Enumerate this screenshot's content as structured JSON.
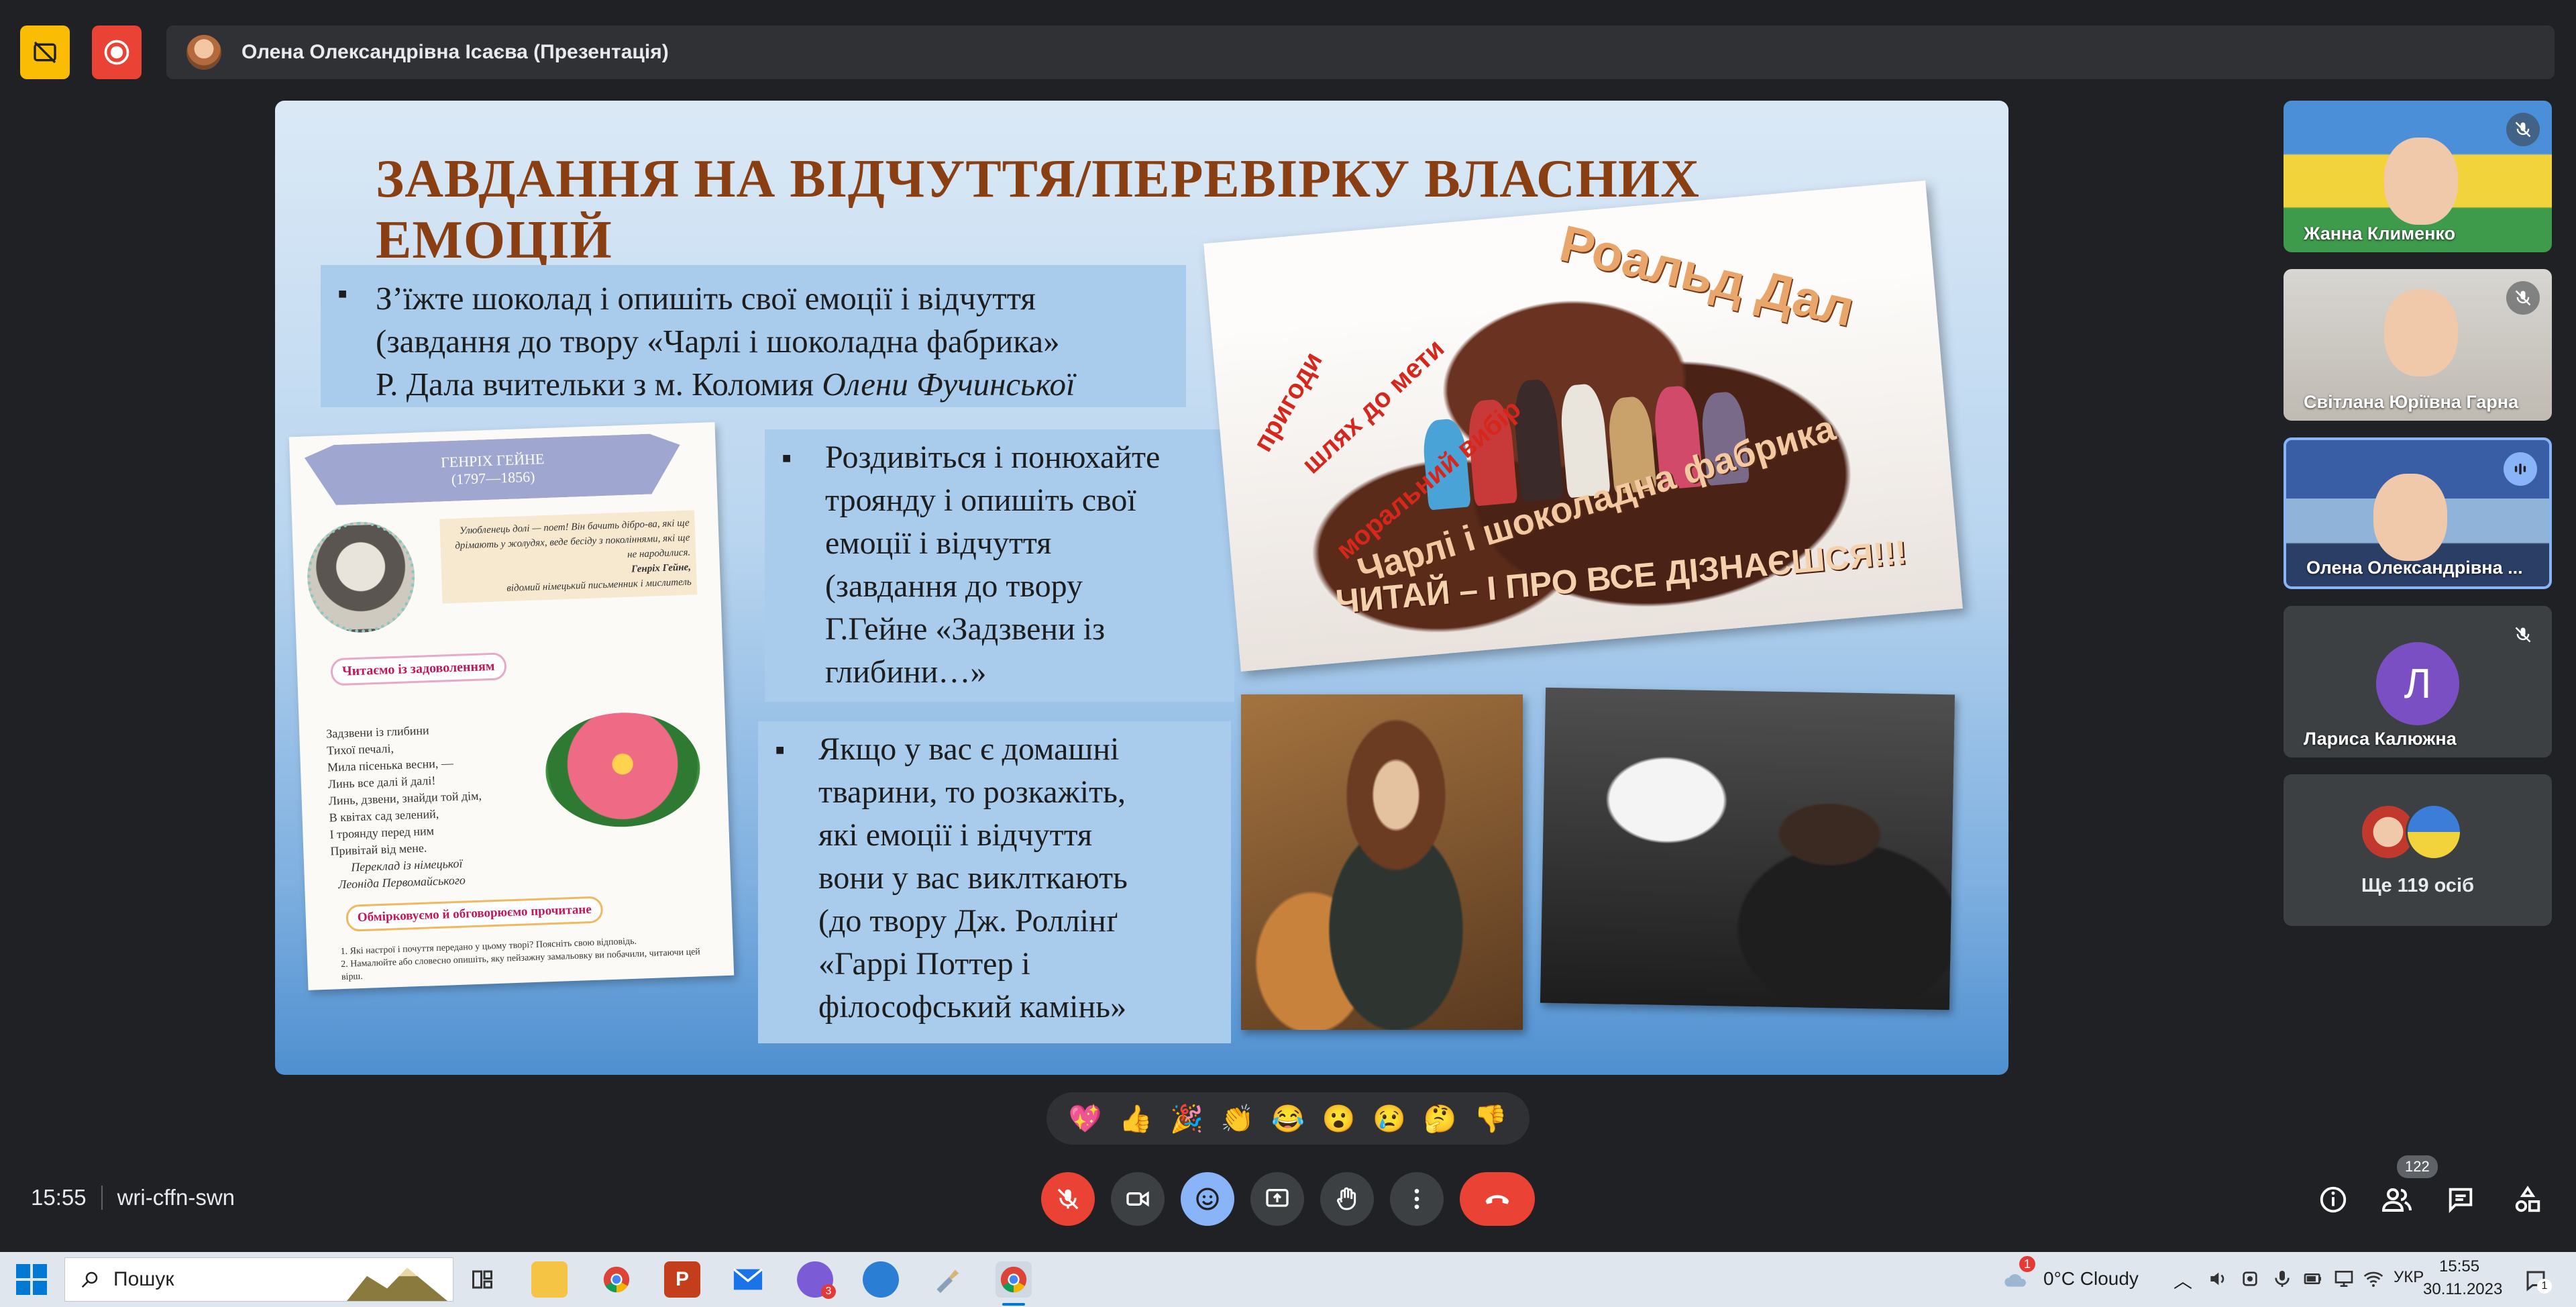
{
  "top_bar": {
    "presenter_name": "Олена Олександрівна Ісаєва (Презентація)"
  },
  "slide": {
    "title": "ЗАВДАННЯ НА ВІДЧУТТЯ/ПЕРЕВІРКУ ВЛАСНИХ  ЕМОЦІЙ",
    "box1_lines": [
      "З’їжте шоколад  і опишіть свої емоції і відчуття",
      "(завдання до твору «Чарлі і шоколадна фабрика»",
      "Р. Дала вчительки з м. Коломия"
    ],
    "box1_italic": "Олени Фучинської",
    "box2_lines": [
      "Роздивіться і понюхайте",
      "троянду і опишіть свої",
      "емоції і відчуття",
      "(завдання до твору",
      "Г.Гейне «Задзвени із",
      "глибини…»"
    ],
    "box3_lines": [
      "Якщо у вас є домашні",
      "тварини, то розкажіть,",
      "які емоції і відчуття",
      "вони у вас виклткають",
      "(до твору Дж. Роллінґ",
      "«Гаррі Поттер і",
      "філософський камінь»"
    ],
    "book": {
      "banner_name": "ГЕНРІХ ГЕЙНЕ",
      "banner_years": "(1797—1856)",
      "quote": "Улюбленець долі — поет! Він бачить дібро-ва, які ще дрімають у жолудях, веде бесіду з поколіннями, які ще не народилися.",
      "quote_author": "Генріх Гейне,",
      "quote_author_desc": "відомий німецький письменник і мислитель",
      "read_label": "Читаємо із задоволенням",
      "poem": [
        "Задзвени із глибини",
        "Тихої печалі,",
        "Мила пісенька весни, —",
        "Линь все далі й далі!",
        "Линь, дзвени, знайди той дім,",
        "В квітах сад зелений,",
        "І троянду перед ним",
        "Привітай від мене."
      ],
      "translation_1": "Переклад із німецької",
      "translation_2": "Леоніда Первомайського",
      "discuss_label": "Обмірковуємо й обговорюємо прочитане",
      "q1": "1. Які настрої і почуття передано у цьому творі? Поясніть свою відповідь.",
      "q2": "2. Намалюйте або словесно опишіть, яку пейзажну замальовку ви побачили, читаючи цей вірш."
    },
    "poster": {
      "author": "Роальд Дал",
      "tag1": "пригоди",
      "tag2": "шлях до мети",
      "tag3": "моральний вибір",
      "book_title": "Чарлі і шоколадна фабрика",
      "call": "ЧИТАЙ – І ПРО ВСЕ ДІЗНАЄШСЯ!!!"
    }
  },
  "participants": [
    {
      "name": "Жанна Клименко",
      "muted": true
    },
    {
      "name": "Світлана Юріївна Гарна",
      "muted": true
    },
    {
      "name": "Олена Олександрівна ...",
      "speaking": true
    },
    {
      "name": "Лариса Калюжна",
      "initial": "Л",
      "muted": true
    },
    {
      "more_label": "Ще 119 осіб"
    }
  ],
  "reactions": [
    "💖",
    "👍",
    "🎉",
    "👏",
    "😂",
    "😮",
    "😢",
    "🤔",
    "👎"
  ],
  "bottom_bar": {
    "time": "15:55",
    "meeting_code": "wri-cffn-swn",
    "people_count": "122"
  },
  "taskbar": {
    "search_placeholder": "Пошук",
    "weather": "0°C  Cloudy",
    "weather_badge": "1",
    "lang": "УКР",
    "clock_time": "15:55",
    "clock_date": "30.11.2023",
    "notif_count": "1"
  },
  "colors": {
    "background": "#202124",
    "accent_blue": "#8ab4f8",
    "red": "#ea4335",
    "yellow": "#fbbc04",
    "slide_title": "#8a3f12"
  }
}
